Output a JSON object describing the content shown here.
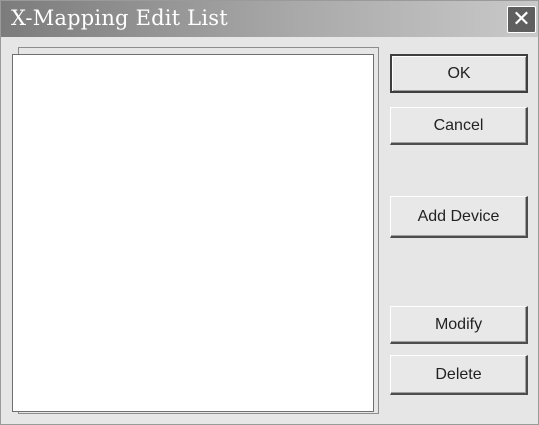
{
  "window": {
    "title": "X-Mapping Edit List",
    "close_glyph": "✕"
  },
  "list": {
    "items": []
  },
  "buttons": {
    "ok": "OK",
    "cancel": "Cancel",
    "add_device": "Add Device",
    "modify": "Modify",
    "delete": "Delete"
  },
  "icons": {
    "close": "close-icon"
  },
  "colors": {
    "dialog_bg": "#e6e6e6",
    "titlebar_dark": "#7c7c7c",
    "titlebar_light": "#c9c9c9",
    "title_text": "#ffffff",
    "list_bg": "#ffffff"
  }
}
